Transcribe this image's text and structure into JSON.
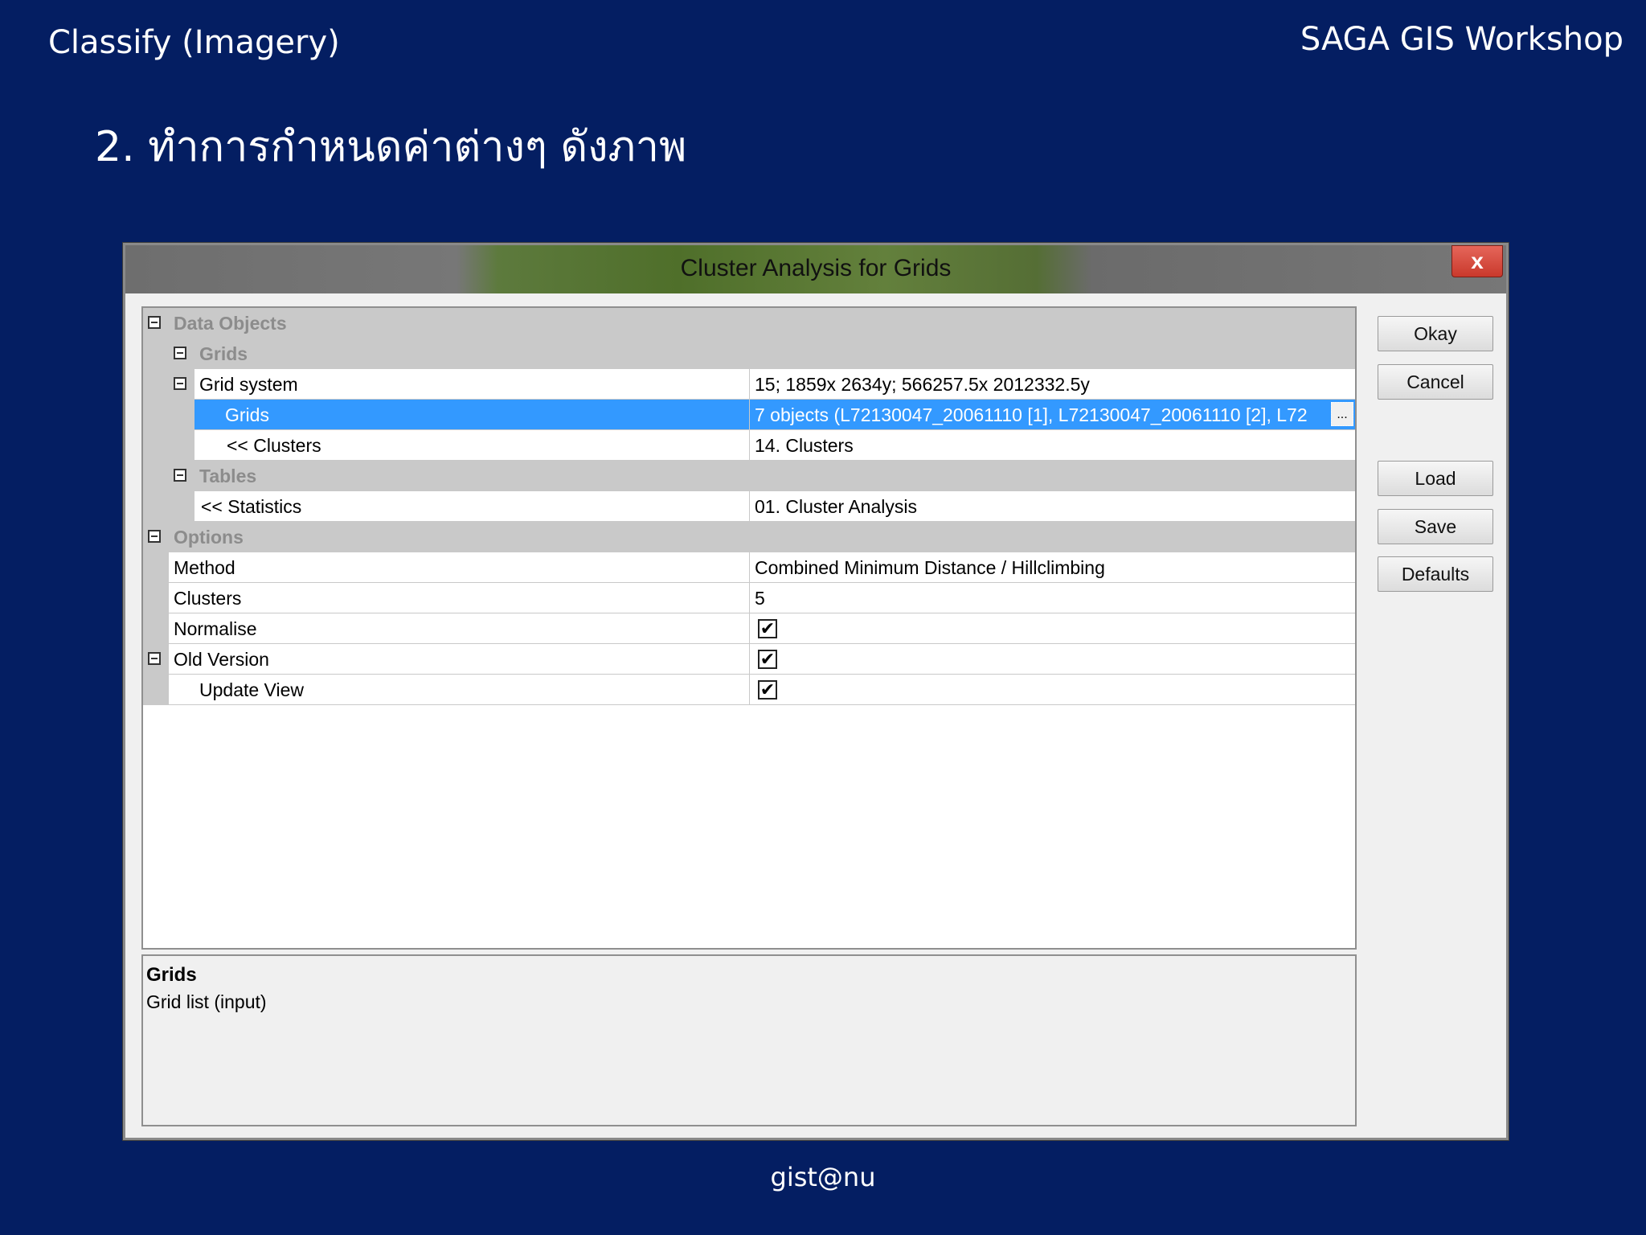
{
  "slide": {
    "section": "Classify (Imagery)",
    "brand": "SAGA GIS Workshop",
    "step": "2. ทำการกำหนดค่าต่างๆ ดังภาพ",
    "footer": "gist@nu"
  },
  "dialog": {
    "title": "Cluster Analysis for Grids",
    "close_label": "x",
    "property_grid": {
      "data_objects": "Data Objects",
      "grids_category": "Grids",
      "grid_system": {
        "label": "Grid system",
        "value": "15; 1859x 2634y; 566257.5x 2012332.5y"
      },
      "grids": {
        "label": "Grids",
        "value": "7 objects (L72130047_20061110 [1], L72130047_20061110 [2], L72"
      },
      "clusters_output": {
        "label": "<< Clusters",
        "value": "14. Clusters"
      },
      "tables_category": "Tables",
      "statistics_output": {
        "label": "<< Statistics",
        "value": "01. Cluster Analysis"
      },
      "options": "Options",
      "method": {
        "label": "Method",
        "value": "Combined Minimum Distance / Hillclimbing"
      },
      "clusters": {
        "label": "Clusters",
        "value": "5"
      },
      "normalise": {
        "label": "Normalise",
        "checked": true
      },
      "old_version": {
        "label": "Old Version",
        "checked": true
      },
      "update_view": {
        "label": "Update View",
        "checked": true
      }
    },
    "description": {
      "heading": "Grids",
      "text": "Grid list (input)"
    },
    "buttons": {
      "okay": "Okay",
      "cancel": "Cancel",
      "load": "Load",
      "save": "Save",
      "defaults": "Defaults"
    },
    "ellipsis": "..."
  }
}
